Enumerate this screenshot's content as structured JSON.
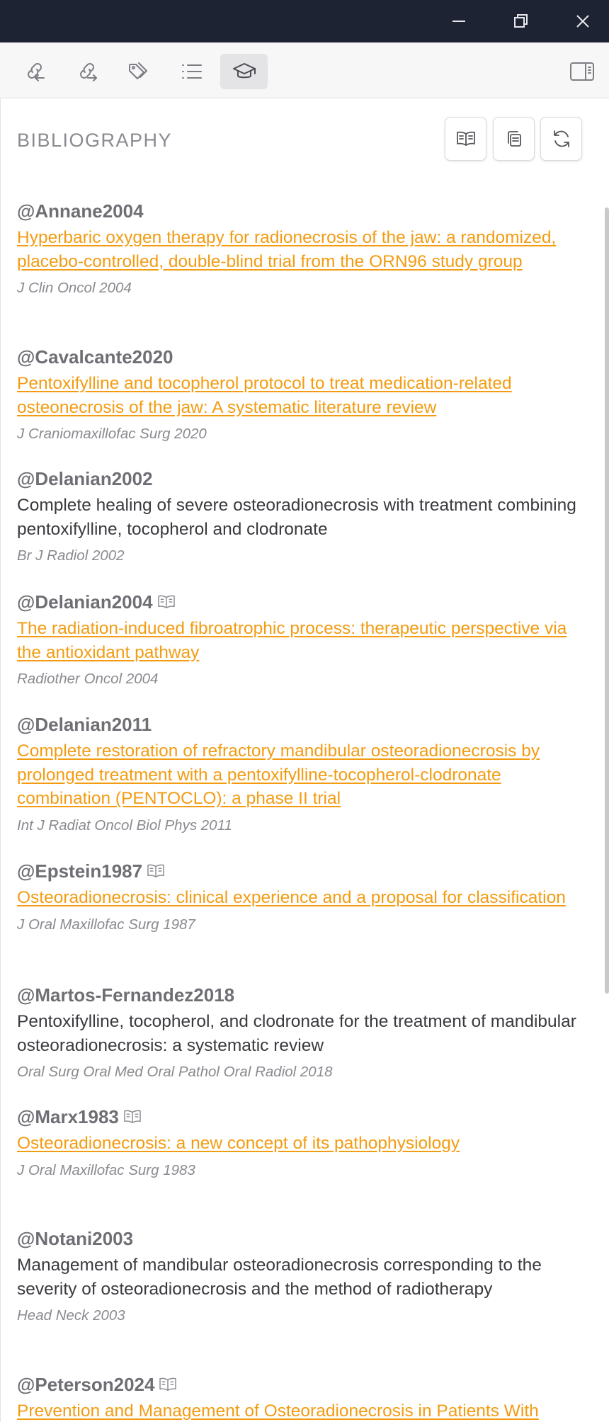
{
  "window": {
    "minimize_icon": "minimize-icon",
    "restore_icon": "restore-icon",
    "close_icon": "close-icon"
  },
  "toolbar": {
    "items": [
      {
        "icon": "backlinks-icon",
        "active": false
      },
      {
        "icon": "outgoing-links-icon",
        "active": false
      },
      {
        "icon": "tags-icon",
        "active": false
      },
      {
        "icon": "outline-list-icon",
        "active": false
      },
      {
        "icon": "graduation-cap-icon",
        "active": true
      }
    ],
    "sidebar_toggle_icon": "sidebar-toggle-icon"
  },
  "bibliography": {
    "title": "BIBLIOGRAPHY",
    "actions": [
      {
        "icon": "open-book-icon"
      },
      {
        "icon": "copy-icon"
      },
      {
        "icon": "refresh-icon"
      }
    ],
    "entries": [
      {
        "key": "@Annane2004",
        "title": "Hyperbaric oxygen therapy for radionecrosis of the jaw: a randomized, placebo-controlled, double-blind trial from the ORN96 study group",
        "journal": "J Clin Oncol 2004",
        "linked": true,
        "has_book": false
      },
      {
        "key": "@Cavalcante2020",
        "title": "Pentoxifylline and tocopherol protocol to treat medication-related osteonecrosis of the jaw: A systematic literature review",
        "journal": "J Craniomaxillofac Surg 2020",
        "linked": true,
        "has_book": false
      },
      {
        "key": "@Delanian2002",
        "title": "Complete healing of severe osteoradionecrosis with treatment combining pentoxifylline, tocopherol and clodronate",
        "journal": "Br J Radiol 2002",
        "linked": false,
        "has_book": false
      },
      {
        "key": "@Delanian2004",
        "title": "The radiation-induced fibroatrophic process: therapeutic perspective via the antioxidant pathway",
        "journal": "Radiother Oncol 2004",
        "linked": true,
        "has_book": true
      },
      {
        "key": "@Delanian2011",
        "title": "Complete restoration of refractory mandibular osteoradionecrosis by prolonged treatment with a pentoxifylline-tocopherol-clodronate combination (PENTOCLO): a phase II trial",
        "journal": "Int J Radiat Oncol Biol Phys 2011",
        "linked": true,
        "has_book": false
      },
      {
        "key": "@Epstein1987",
        "title": "Osteoradionecrosis: clinical experience and a proposal for classification",
        "journal": "J Oral Maxillofac Surg 1987",
        "linked": true,
        "has_book": true
      },
      {
        "key": "@Martos-Fernandez2018",
        "title": "Pentoxifylline, tocopherol, and clodronate for the treatment of mandibular osteoradionecrosis: a systematic review",
        "journal": "Oral Surg Oral Med Oral Pathol Oral Radiol 2018",
        "linked": false,
        "has_book": false
      },
      {
        "key": "@Marx1983",
        "title": "Osteoradionecrosis: a new concept of its pathophysiology",
        "journal": "J Oral Maxillofac Surg 1983",
        "linked": true,
        "has_book": true
      },
      {
        "key": "@Notani2003",
        "title": "Management of mandibular osteoradionecrosis corresponding to the severity of osteoradionecrosis and the method of radiotherapy",
        "journal": "Head Neck 2003",
        "linked": false,
        "has_book": false
      },
      {
        "key": "@Peterson2024",
        "title": "Prevention and Management of Osteoradionecrosis in Patients With Head and Neck Cancer Treated With Radiation Therapy:",
        "journal": "",
        "linked": true,
        "has_book": true
      }
    ]
  },
  "colors": {
    "titlebar": "#1e2334",
    "link": "#f39c12",
    "citekey": "#6e6e74",
    "journal": "#8a8a90"
  }
}
